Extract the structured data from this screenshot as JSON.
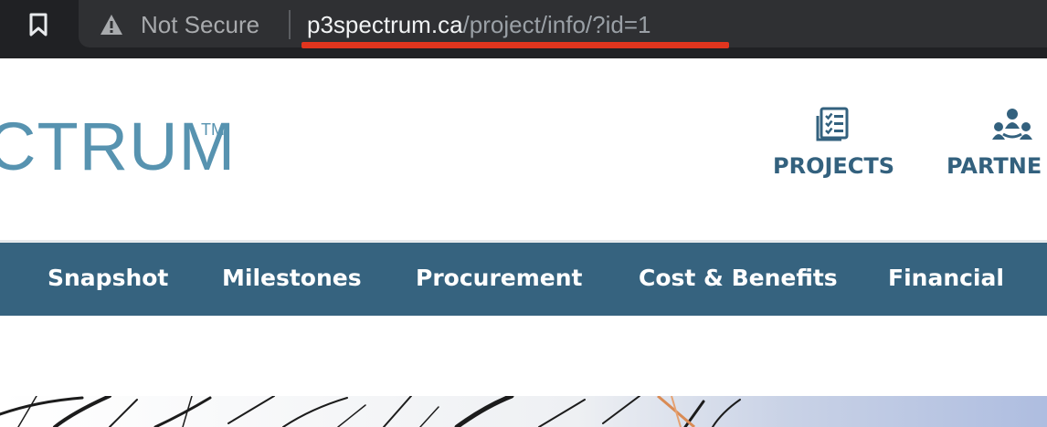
{
  "browser": {
    "security_label": "Not Secure",
    "url_host": "p3spectrum.ca",
    "url_path": "/project/info/?id=1",
    "highlight_color": "#e1351e"
  },
  "site": {
    "logo_text": "CTRUM",
    "logo_tm": "TM",
    "brand_color": "#5793b0",
    "nav": {
      "projects_label": "PROJECTS",
      "partners_label": "PARTNE",
      "projects_icon": "checklist-icon",
      "partners_icon": "people-icon"
    }
  },
  "tabs": {
    "background": "#36637f",
    "items": [
      {
        "label": "Snapshot"
      },
      {
        "label": "Milestones"
      },
      {
        "label": "Procurement"
      },
      {
        "label": "Cost & Benefits"
      },
      {
        "label": "Financial"
      }
    ]
  }
}
